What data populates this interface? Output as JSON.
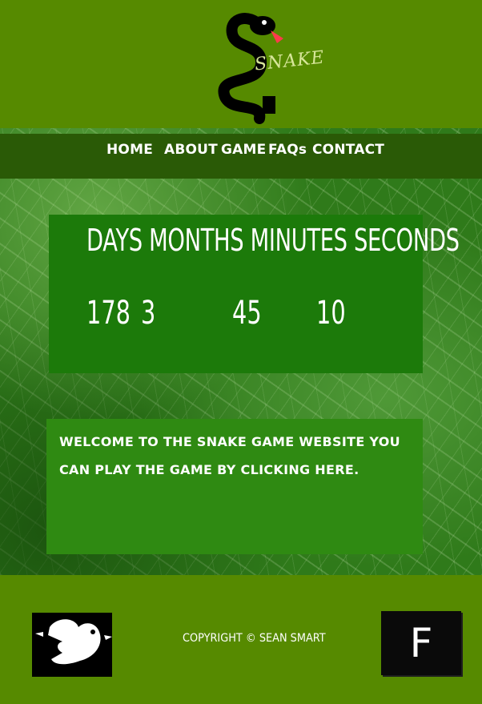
{
  "header": {
    "logo_text": "SNAKE",
    "colors": {
      "background": "#568a00",
      "snake": "#000000",
      "tongue": "#ff3b4a"
    }
  },
  "nav": {
    "items": [
      {
        "label": "HOME"
      },
      {
        "label": "ABOUT"
      },
      {
        "label": "GAME"
      },
      {
        "label": "FAQs"
      },
      {
        "label": "CONTACT"
      }
    ],
    "color": "#2a5a06"
  },
  "countdown": {
    "labels": [
      "DAYS",
      "MONTHS",
      "MINUTES",
      "SECONDS"
    ],
    "values": {
      "days": "178",
      "months": "3",
      "minutes": "45",
      "seconds": "10"
    },
    "color": "#1c7a0a"
  },
  "welcome": {
    "text": "WELCOME TO THE SNAKE GAME WEBSITE YOU CAN PLAY THE GAME BY CLICKING HERE.",
    "color": "#2f8a12"
  },
  "footer": {
    "copyright": "COPYRIGHT © SEAN SMART",
    "social_left_icon": "bird-logo-icon",
    "social_right_icon": "facebook-icon",
    "social_right_letter": "F"
  }
}
